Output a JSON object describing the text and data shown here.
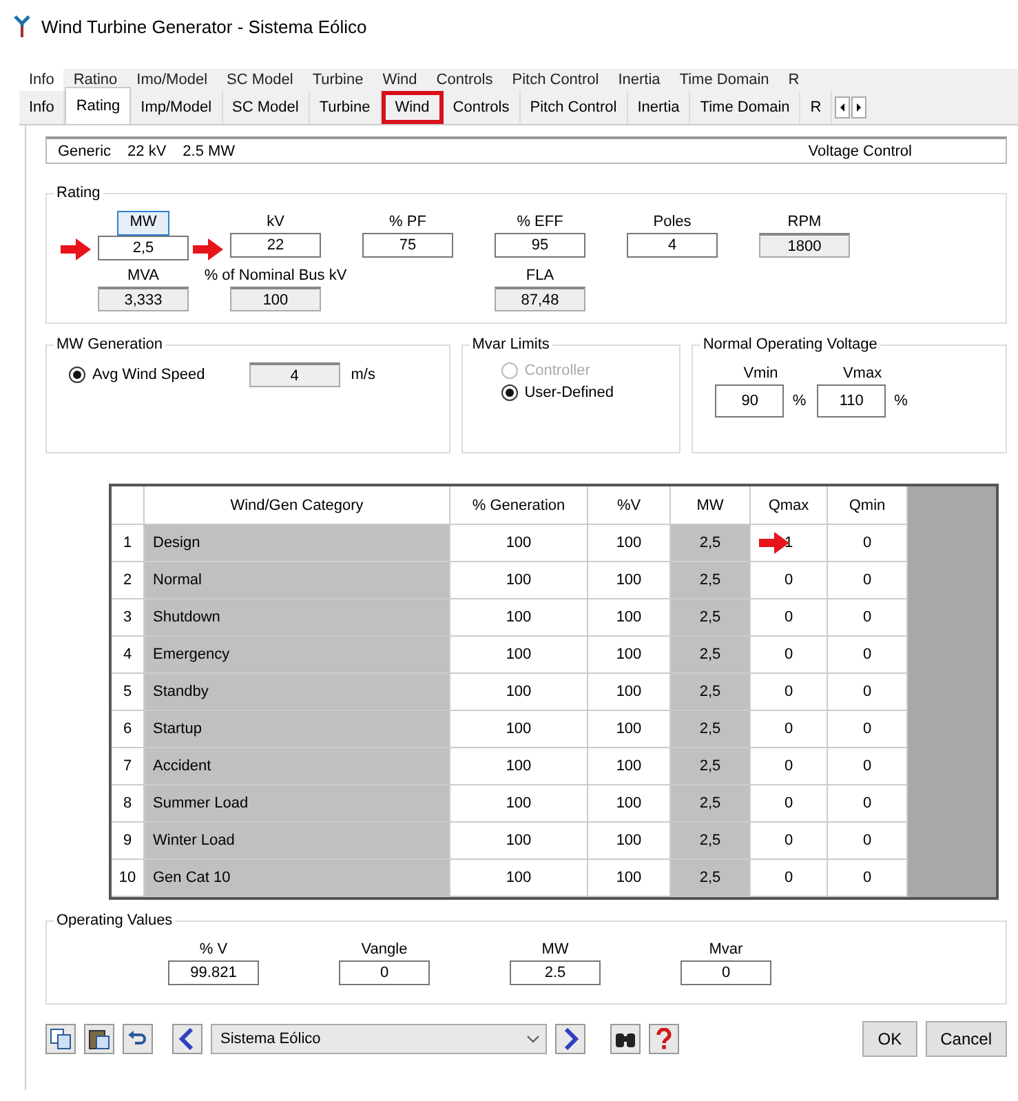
{
  "window": {
    "title": "Wind Turbine Generator - Sistema Eólico"
  },
  "upper_tabs": [
    {
      "label": "Info",
      "selected": true
    },
    {
      "label": "Ratino",
      "selected": false
    },
    {
      "label": "Imo/Model",
      "selected": false
    },
    {
      "label": "SC Model",
      "selected": false
    },
    {
      "label": "Turbine",
      "selected": false
    },
    {
      "label": "Wind",
      "selected": false
    },
    {
      "label": "Controls",
      "selected": false
    },
    {
      "label": "Pitch Control",
      "selected": false
    },
    {
      "label": "Inertia",
      "selected": false
    },
    {
      "label": "Time Domain",
      "selected": false
    },
    {
      "label": "R",
      "selected": false
    }
  ],
  "tabs": [
    {
      "label": "Info",
      "selected": false,
      "highlighted": false
    },
    {
      "label": "Rating",
      "selected": true,
      "highlighted": false
    },
    {
      "label": "Imp/Model",
      "selected": false,
      "highlighted": false
    },
    {
      "label": "SC Model",
      "selected": false,
      "highlighted": false
    },
    {
      "label": "Turbine",
      "selected": false,
      "highlighted": false
    },
    {
      "label": "Wind",
      "selected": false,
      "highlighted": true
    },
    {
      "label": "Controls",
      "selected": false,
      "highlighted": false
    },
    {
      "label": "Pitch Control",
      "selected": false,
      "highlighted": false
    },
    {
      "label": "Inertia",
      "selected": false,
      "highlighted": false
    },
    {
      "label": "Time Domain",
      "selected": false,
      "highlighted": false
    },
    {
      "label": "R",
      "selected": false,
      "highlighted": false
    }
  ],
  "info_bar": {
    "type": "Generic",
    "kv": "22 kV",
    "mw": "2.5 MW",
    "mode": "Voltage Control"
  },
  "rating": {
    "title": "Rating",
    "fields": [
      {
        "label": "MW",
        "value": "2,5",
        "readonly": false,
        "marked": true,
        "label_boxed": true
      },
      {
        "label": "kV",
        "value": "22",
        "readonly": false,
        "marked": true,
        "label_boxed": false
      },
      {
        "label": "% PF",
        "value": "75",
        "readonly": false,
        "marked": false,
        "label_boxed": false
      },
      {
        "label": "% EFF",
        "value": "95",
        "readonly": false,
        "marked": false,
        "label_boxed": false
      },
      {
        "label": "Poles",
        "value": "4",
        "readonly": false,
        "marked": false,
        "label_boxed": false
      },
      {
        "label": "RPM",
        "value": "1800",
        "readonly": true,
        "marked": false,
        "label_boxed": false
      },
      {
        "label": "MVA",
        "value": "3,333",
        "readonly": true,
        "marked": false,
        "label_boxed": false
      },
      {
        "label": "% of Nominal Bus kV",
        "value": "100",
        "readonly": true,
        "marked": false,
        "label_boxed": false
      },
      {
        "label": "FLA",
        "value": "87,48",
        "readonly": true,
        "marked": false,
        "label_boxed": false
      }
    ]
  },
  "mw_generation": {
    "title": "MW Generation",
    "option": {
      "label": "Avg Wind Speed",
      "selected": true
    },
    "value": "4",
    "unit": "m/s"
  },
  "mvar_limits": {
    "title": "Mvar Limits",
    "options": [
      {
        "label": "Controller",
        "selected": false,
        "disabled": true
      },
      {
        "label": "User-Defined",
        "selected": true,
        "disabled": false
      }
    ]
  },
  "operating_voltage": {
    "title": "Normal Operating Voltage",
    "fields": [
      {
        "label": "Vmin",
        "value": "90",
        "unit": "%"
      },
      {
        "label": "Vmax",
        "value": "110",
        "unit": "%"
      }
    ]
  },
  "table": {
    "columns": [
      "Wind/Gen Category",
      "% Generation",
      "%V",
      "MW",
      "Qmax",
      "Qmin"
    ],
    "rows": [
      {
        "number": "1",
        "cells": [
          "Design",
          "100",
          "100",
          "2,5",
          "1",
          "0"
        ],
        "qmax_marked": true
      },
      {
        "number": "2",
        "cells": [
          "Normal",
          "100",
          "100",
          "2,5",
          "0",
          "0"
        ],
        "qmax_marked": false
      },
      {
        "number": "3",
        "cells": [
          "Shutdown",
          "100",
          "100",
          "2,5",
          "0",
          "0"
        ],
        "qmax_marked": false
      },
      {
        "number": "4",
        "cells": [
          "Emergency",
          "100",
          "100",
          "2,5",
          "0",
          "0"
        ],
        "qmax_marked": false
      },
      {
        "number": "5",
        "cells": [
          "Standby",
          "100",
          "100",
          "2,5",
          "0",
          "0"
        ],
        "qmax_marked": false
      },
      {
        "number": "6",
        "cells": [
          "Startup",
          "100",
          "100",
          "2,5",
          "0",
          "0"
        ],
        "qmax_marked": false
      },
      {
        "number": "7",
        "cells": [
          "Accident",
          "100",
          "100",
          "2,5",
          "0",
          "0"
        ],
        "qmax_marked": false
      },
      {
        "number": "8",
        "cells": [
          "Summer Load",
          "100",
          "100",
          "2,5",
          "0",
          "0"
        ],
        "qmax_marked": false
      },
      {
        "number": "9",
        "cells": [
          "Winter Load",
          "100",
          "100",
          "2,5",
          "0",
          "0"
        ],
        "qmax_marked": false
      },
      {
        "number": "10",
        "cells": [
          "Gen Cat 10",
          "100",
          "100",
          "2,5",
          "0",
          "0"
        ],
        "qmax_marked": false
      }
    ]
  },
  "operating_values": {
    "title": "Operating Values",
    "fields": [
      {
        "label": "% V",
        "value": "99.821"
      },
      {
        "label": "Vangle",
        "value": "0"
      },
      {
        "label": "MW",
        "value": "2.5"
      },
      {
        "label": "Mvar",
        "value": "0"
      }
    ]
  },
  "footer": {
    "selector": "Sistema Eólico",
    "buttons": [
      "OK",
      "Cancel"
    ]
  }
}
